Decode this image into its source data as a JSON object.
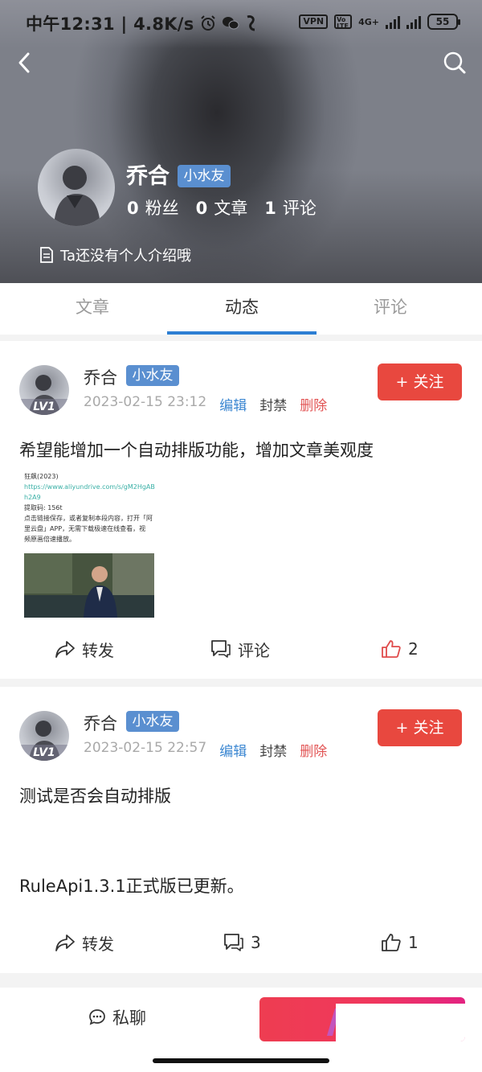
{
  "status_bar": {
    "time": "中午12:31 | 4.8K/s",
    "vpn": "VPN",
    "volte": "Vo LTE",
    "network": "4G+",
    "battery": "55"
  },
  "profile": {
    "name": "乔合",
    "badge": "小水友",
    "stats": [
      {
        "value": "0",
        "label": "粉丝"
      },
      {
        "value": "0",
        "label": "文章"
      },
      {
        "value": "1",
        "label": "评论"
      }
    ],
    "bio": "Ta还没有个人介绍哦"
  },
  "tabs": [
    {
      "label": "文章",
      "active": false
    },
    {
      "label": "动态",
      "active": true
    },
    {
      "label": "评论",
      "active": false
    }
  ],
  "posts": [
    {
      "author": "乔合",
      "badge": "小水友",
      "level": "LV1",
      "time": "2023-02-15 23:12",
      "edit": "编辑",
      "ban": "封禁",
      "delete": "删除",
      "follow": "+ 关注",
      "text": "希望能增加一个自动排版功能，增加文章美观度",
      "attachment": {
        "title": "狂飙(2023)",
        "link_line1": "https://www.aliyundrive.com/s/gM2HgAB",
        "link_line2": "h2A9",
        "code": "提取码: 156t",
        "desc_line1": "点击链接保存，或者复制本段内容，打开「阿",
        "desc_line2": "里云盘」APP，无需下载极速在线查看，视",
        "desc_line3": "频原画倍速播放。"
      },
      "actions": {
        "share": "转发",
        "comment": "评论",
        "likes": "2"
      }
    },
    {
      "author": "乔合",
      "badge": "小水友",
      "level": "LV1",
      "time": "2023-02-15 22:57",
      "edit": "编辑",
      "ban": "封禁",
      "delete": "删除",
      "follow": "+ 关注",
      "text_line1": "测试是否会自动排版",
      "text_line2": "RuleApi1.3.1正式版已更新。",
      "actions": {
        "share": "转发",
        "comments": "3",
        "likes": "1"
      }
    }
  ],
  "bottom_bar": {
    "chat": "私聊"
  },
  "colors": {
    "accent_blue": "#2d7fd3",
    "badge_blue": "#5a8fd0",
    "follow_red": "#e8483f",
    "delete_red": "#e25555",
    "like_red": "#e04b4b"
  }
}
